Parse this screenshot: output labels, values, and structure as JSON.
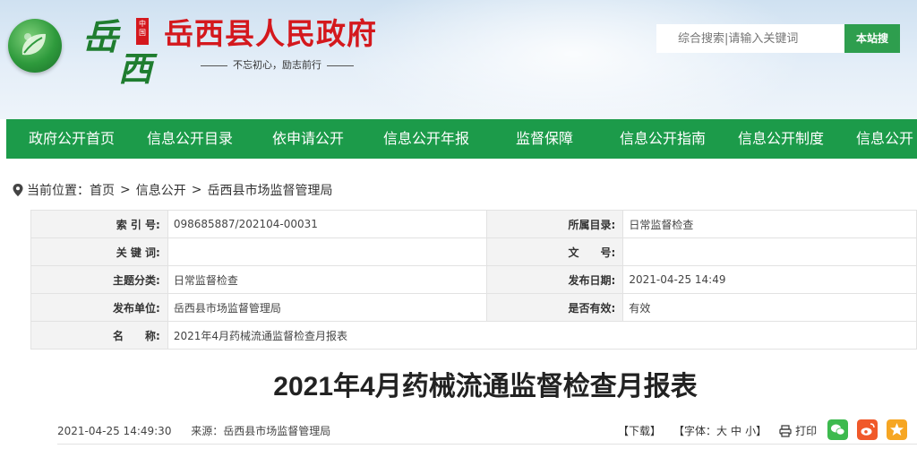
{
  "header": {
    "seal_text": "中国",
    "calligraphy_1": "岳",
    "calligraphy_2": "西",
    "title": "岳西县人民政府",
    "slogan": "不忘初心，励志前行",
    "search_placeholder": "综合搜索|请输入关键词",
    "search_button": "本站搜"
  },
  "nav": {
    "items": [
      "政府公开首页",
      "信息公开目录",
      "依申请公开",
      "信息公开年报",
      "监督保障",
      "信息公开指南",
      "信息公开制度",
      "信息公开"
    ]
  },
  "breadcrumb": {
    "prefix": "当前位置：",
    "items": [
      "首页",
      "信息公开",
      "岳西县市场监督管理局"
    ],
    "separator": ">"
  },
  "meta": {
    "index_label": "索 引 号:",
    "index_value": "098685887/202104-00031",
    "catalog_label": "所属目录:",
    "catalog_value": "日常监督检查",
    "keywords_label": "关 键 词:",
    "keywords_value": "",
    "docno_label": "文　　号:",
    "docno_value": "",
    "topic_label": "主题分类:",
    "topic_value": "日常监督检查",
    "date_label": "发布日期:",
    "date_value": "2021-04-25 14:49",
    "unit_label": "发布单位:",
    "unit_value": "岳西县市场监督管理局",
    "valid_label": "是否有效:",
    "valid_value": "有效",
    "name_label": "名　　称:",
    "name_value": "2021年4月药械流通监督检查月报表"
  },
  "article": {
    "title": "2021年4月药械流通监督检查月报表",
    "datetime": "2021-04-25 14:49:30",
    "source_label": "来源：",
    "source": "岳西县市场监督管理局",
    "download": "【下载】",
    "fontsize_label": "【字体：",
    "font_large": "大",
    "font_medium": "中",
    "font_small": "小",
    "fontsize_end": "】",
    "print": "打印"
  },
  "colors": {
    "nav_green": "#1c9b4a",
    "title_red": "#d4181d",
    "wechat": "#3dba4e",
    "weibo": "#f0592a",
    "qzone": "#f6a623"
  }
}
